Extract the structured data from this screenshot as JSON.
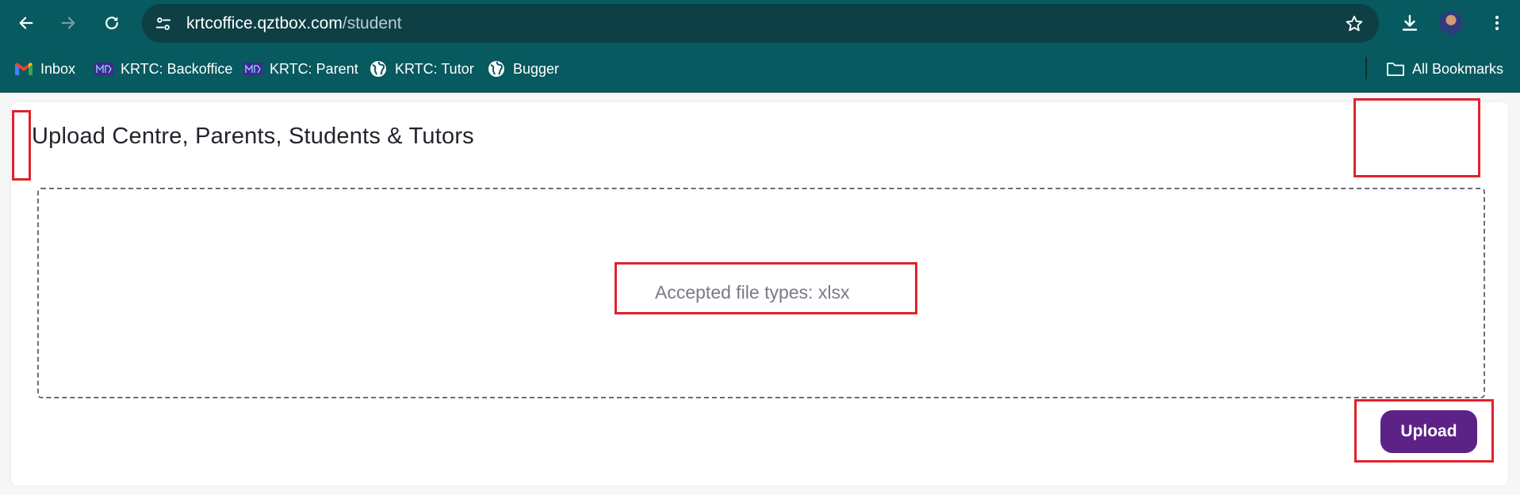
{
  "browser": {
    "url_host": "krtcoffice.qztbox.com",
    "url_path": "/student",
    "bookmarks": [
      {
        "label": "Inbox",
        "icon": "gmail-icon"
      },
      {
        "label": "KRTC: Backoffice",
        "icon": "krtc-icon"
      },
      {
        "label": "KRTC: Parent",
        "icon": "krtc-icon"
      },
      {
        "label": "KRTC: Tutor",
        "icon": "globe-icon"
      },
      {
        "label": "Bugger",
        "icon": "globe-icon"
      }
    ],
    "all_bookmarks_label": "All Bookmarks"
  },
  "page": {
    "title": "Upload Centre, Parents, Students & Tutors",
    "dropzone_text": "Accepted file types: xlsx",
    "upload_label": "Upload"
  },
  "colors": {
    "chrome": "#075a5f",
    "omnibox": "#0d3f44",
    "accent": "#5c2286",
    "highlight": "#e0222d"
  }
}
